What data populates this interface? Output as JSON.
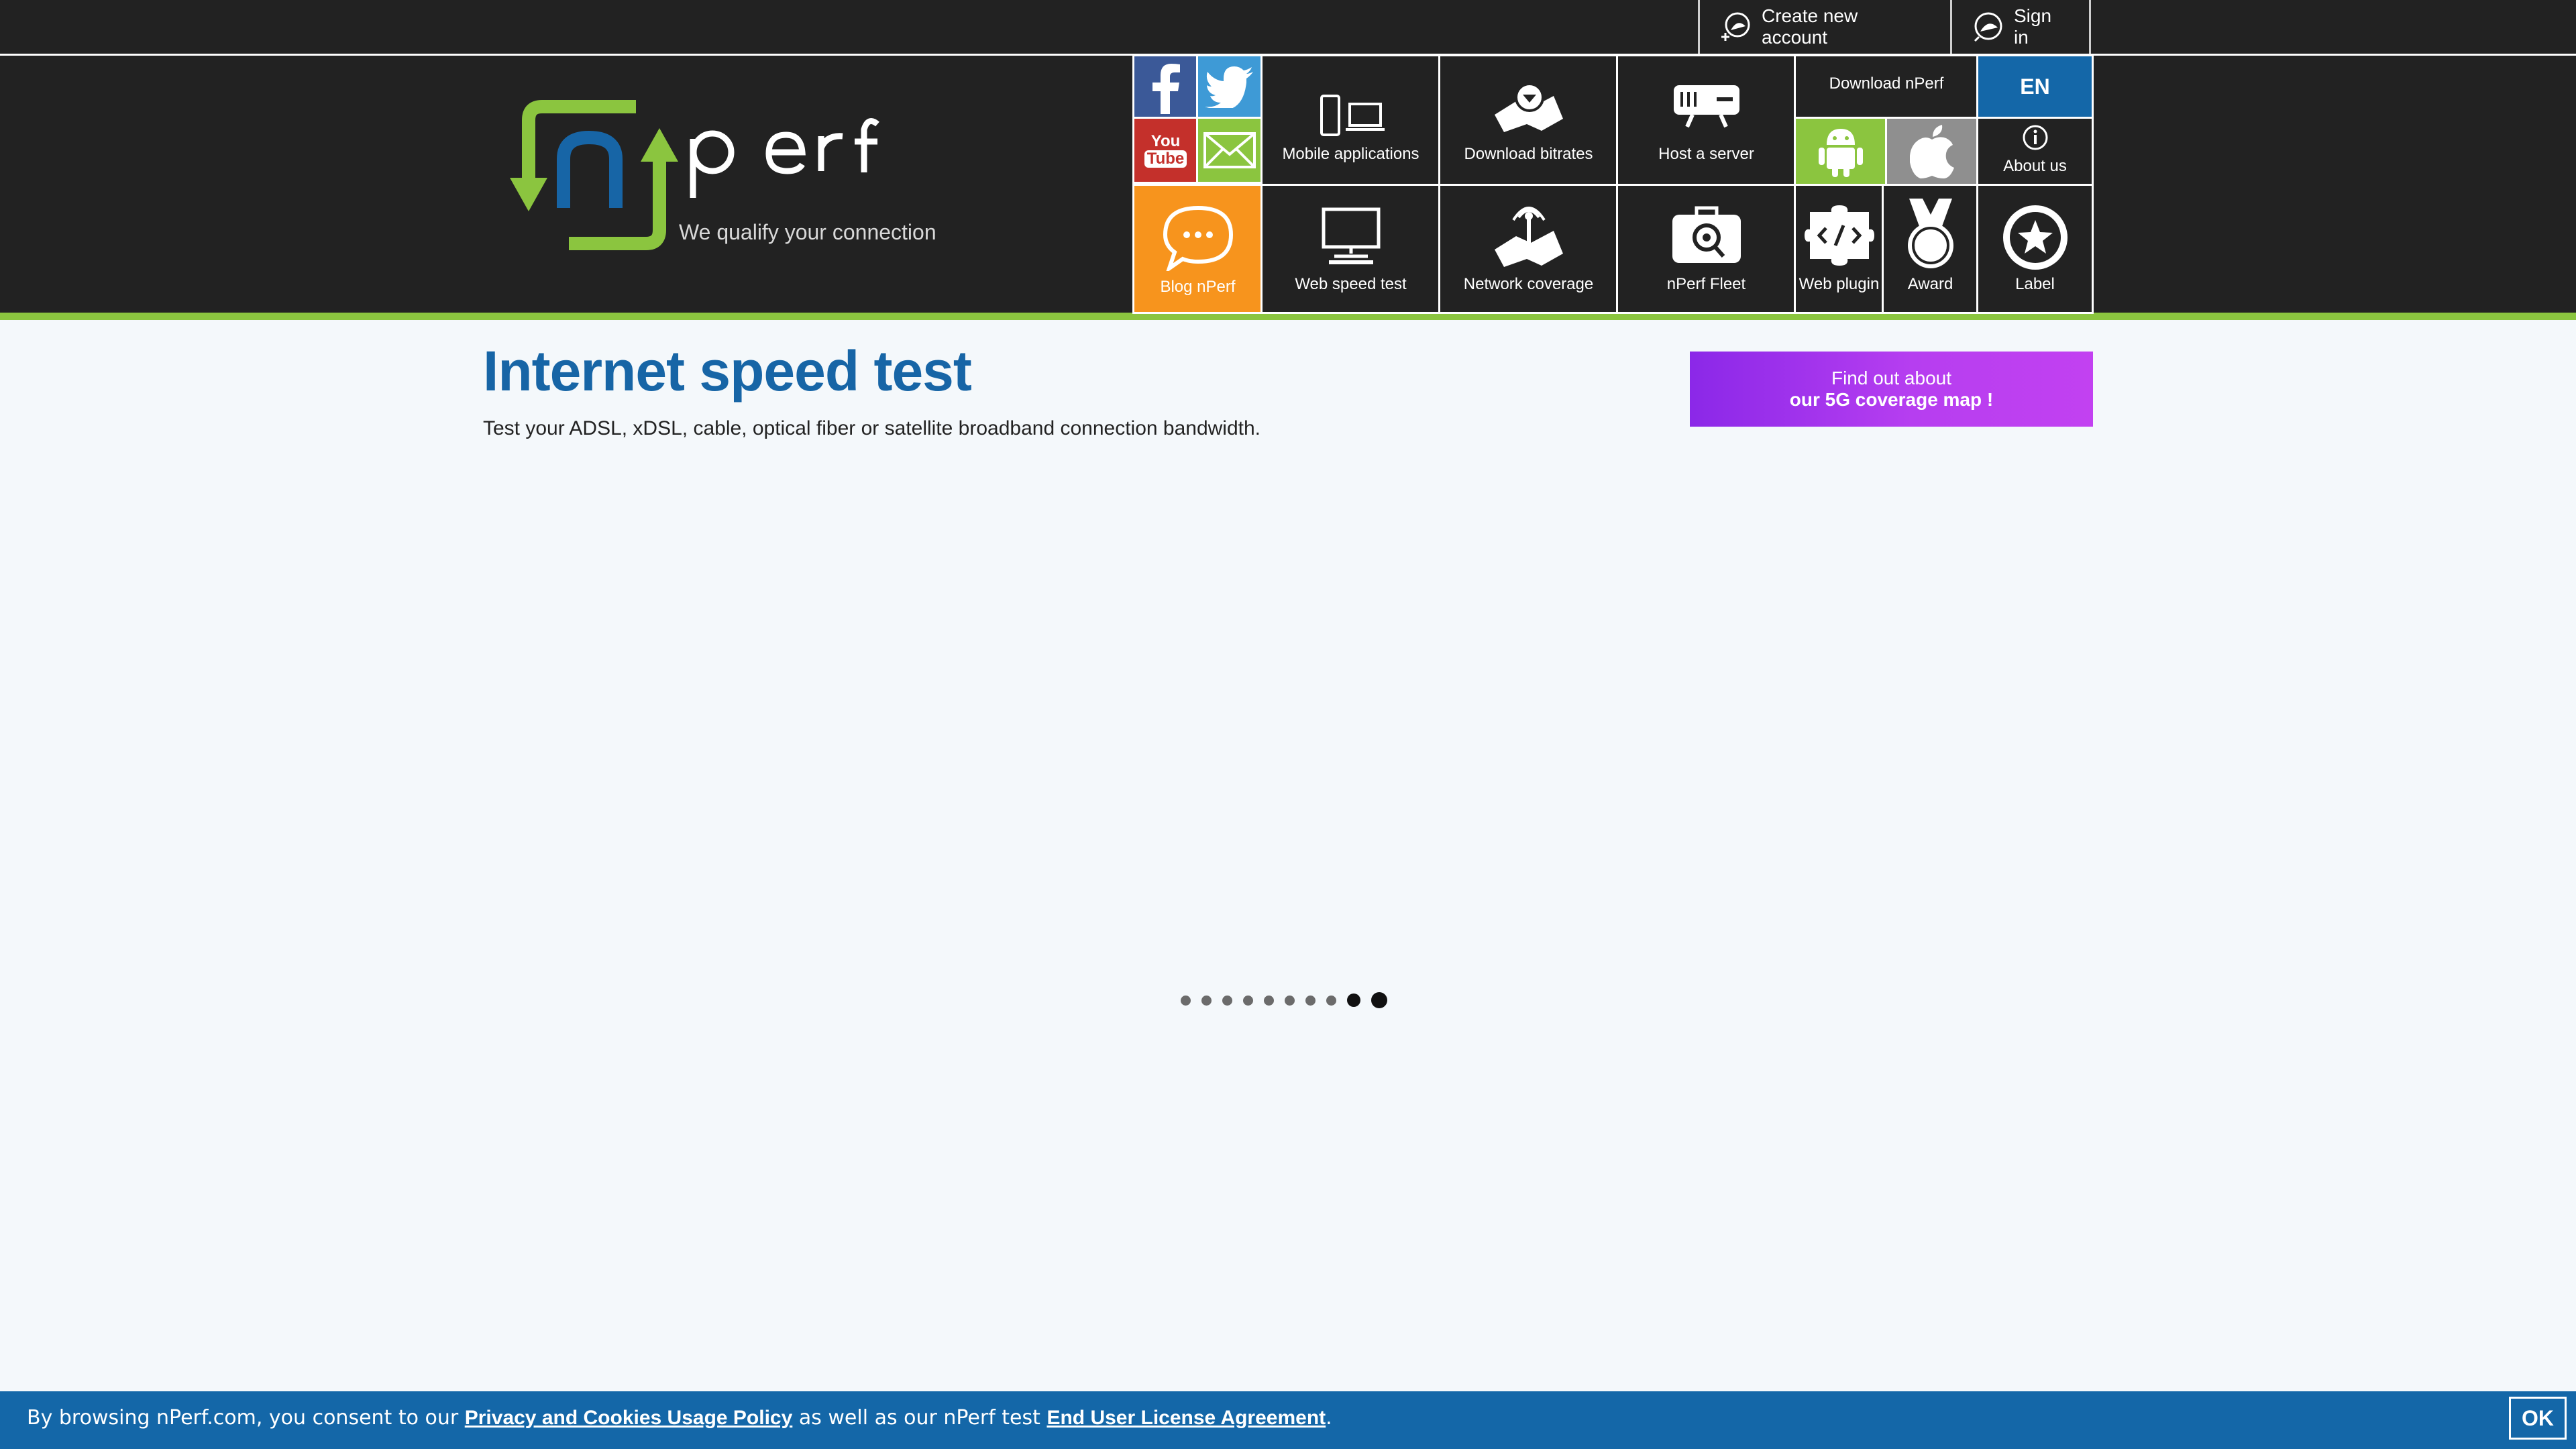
{
  "account": {
    "create_label": "Create new account",
    "signin_label": "Sign in"
  },
  "logo": {
    "brand": "nperf",
    "tagline": "We qualify your connection"
  },
  "nav": {
    "mobile_apps": "Mobile applications",
    "download_bitrates": "Download bitrates",
    "host_server": "Host a server",
    "download_nperf": "Download nPerf",
    "language": "EN",
    "about_us": "About us",
    "blog": "Blog nPerf",
    "web_speed_test": "Web speed test",
    "network_coverage": "Network coverage",
    "nperf_fleet": "nPerf Fleet",
    "web_plugin": "Web plugin",
    "award": "Award",
    "label": "Label"
  },
  "social": {
    "youtube_line1": "You",
    "youtube_line2": "Tube"
  },
  "main": {
    "title": "Internet speed test",
    "subtitle": "Test your ADSL, xDSL, cable, optical fiber or satellite broadband connection bandwidth."
  },
  "promo": {
    "line1": "Find out about",
    "line2": "our 5G coverage map !"
  },
  "cookie": {
    "text_before": "By browsing nPerf.com, you consent to our ",
    "privacy_link": "Privacy and Cookies Usage Policy",
    "text_middle": " as well as our nPerf test ",
    "eula_link": "End User License Agreement",
    "text_after": ".",
    "ok_label": "OK"
  },
  "colors": {
    "header_bg": "#222222",
    "accent_green": "#8bc53f",
    "title_blue": "#1765a6",
    "blog_orange": "#f7941d",
    "lang_blue": "#1467a8",
    "promo_purple": "#a535ee",
    "cookie_blue": "#1467a8"
  },
  "icons": {
    "facebook": "facebook-icon",
    "twitter": "twitter-icon",
    "youtube": "youtube-icon",
    "email": "email-icon",
    "android": "android-icon",
    "apple": "apple-icon"
  }
}
